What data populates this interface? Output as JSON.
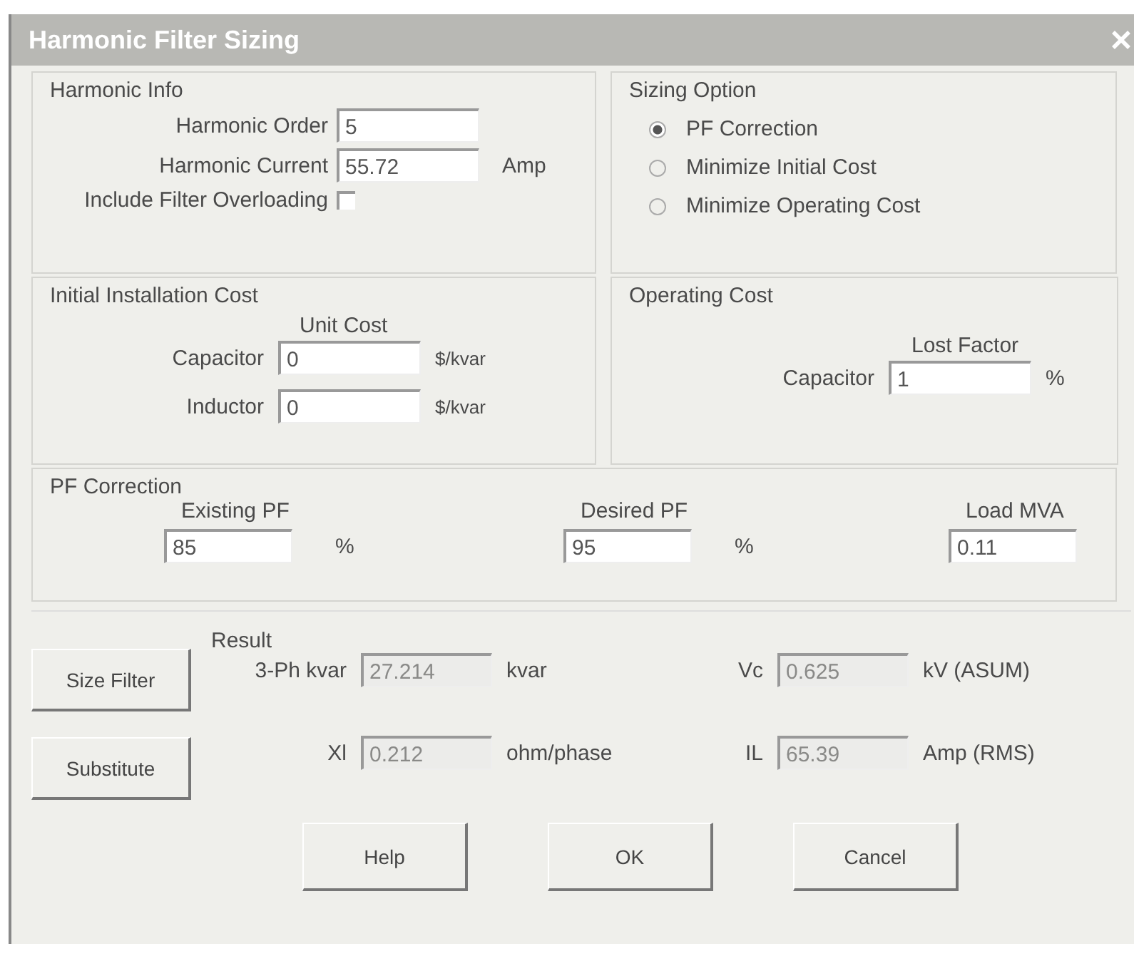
{
  "window": {
    "title": "Harmonic Filter Sizing"
  },
  "harmonic_info": {
    "title": "Harmonic Info",
    "fields": [
      {
        "label": "Harmonic Order",
        "value": "5"
      },
      {
        "label": "Harmonic Current",
        "value": "55.72",
        "unit": "Amp"
      }
    ],
    "overloading": {
      "label": "Include Filter Overloading",
      "checked": false
    }
  },
  "sizing_option": {
    "title": "Sizing Option",
    "options": [
      {
        "label": "PF Correction",
        "selected": true
      },
      {
        "label": "Minimize Initial Cost",
        "selected": false
      },
      {
        "label": "Minimize Operating Cost",
        "selected": false
      }
    ]
  },
  "initial_cost": {
    "title": "Initial Installation Cost",
    "column_label": "Unit Cost",
    "fields": [
      {
        "label": "Capacitor",
        "value": "0",
        "unit": "$/kvar"
      },
      {
        "label": "Inductor",
        "value": "0",
        "unit": "$/kvar"
      }
    ]
  },
  "operating_cost": {
    "title": "Operating Cost",
    "column_label": "Lost Factor",
    "fields": [
      {
        "label": "Capacitor",
        "value": "1",
        "unit": "%"
      }
    ]
  },
  "pf_correction": {
    "title": "PF Correction",
    "fields": [
      {
        "label": "Existing PF",
        "value": "85",
        "unit": "%"
      },
      {
        "label": "Desired PF",
        "value": "95",
        "unit": "%"
      },
      {
        "label": "Load MVA",
        "value": "0.11"
      }
    ]
  },
  "actions": [
    "Size Filter",
    "Substitute"
  ],
  "result": {
    "title": "Result",
    "fields": [
      {
        "label": "3-Ph kvar",
        "value": "27.214",
        "unit": "kvar",
        "disabled": true
      },
      {
        "label": "Vc",
        "value": "0.625",
        "unit": "kV (ASUM)",
        "disabled": true
      },
      {
        "label": "Xl",
        "value": "0.212",
        "unit": "ohm/phase",
        "disabled": true
      },
      {
        "label": "IL",
        "value": "65.39",
        "unit": "Amp (RMS)",
        "disabled": true
      }
    ]
  },
  "buttons": [
    "Help",
    "OK",
    "Cancel"
  ]
}
